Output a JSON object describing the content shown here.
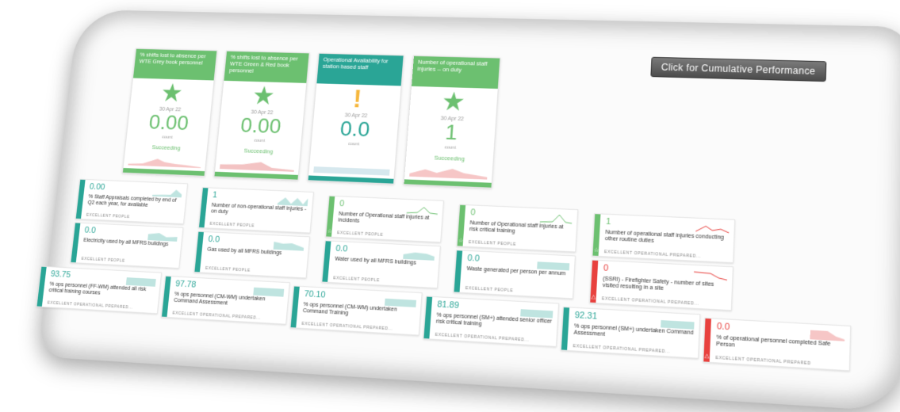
{
  "cumulative_button": "Click for Cumulative Performance",
  "kpis": [
    {
      "title": "% shifts lost to absence per WTE Grey book personnel",
      "date": "30 Apr 22",
      "value": "0.00",
      "unit": "count",
      "status": "Succeeding",
      "color": "#6cc070",
      "icon": "star-icon"
    },
    {
      "title": "% shifts lost to absence per WTE Green & Red book personnel",
      "date": "30 Apr 22",
      "value": "0.00",
      "unit": "count",
      "status": "Succeeding",
      "color": "#6cc070",
      "icon": "star-icon"
    },
    {
      "title": "Operational Availability for station based staff",
      "date": "30 Apr 22",
      "value": "0.0",
      "unit": "count",
      "status": "",
      "color": "#2aa596",
      "icon": "exclamation-icon"
    },
    {
      "title": "Number of operational staff injuries -- on duty",
      "date": "30 Apr 22",
      "value": "1",
      "unit": "count",
      "status": "Succeeding",
      "color": "#6cc070",
      "icon": "star-icon"
    }
  ],
  "tiles": [
    {
      "value": "0.00",
      "label": "% Staff Appraisals completed by end of Q2 each year, for available",
      "category": "EXCELLENT PEOPLE",
      "color": "#2aa596"
    },
    {
      "value": "1",
      "label": "Number of non-operational staff injuries - on duty",
      "category": "EXCELLENT PEOPLE",
      "color": "#2aa596"
    },
    {
      "value": "0",
      "label": "Number of Operational staff injuries at incidents",
      "category": "EXCELLENT PEOPLE",
      "color": "#6cc070"
    },
    {
      "value": "0",
      "label": "Number of Operational staff injuries at risk critical training",
      "category": "EXCELLENT PEOPLE",
      "color": "#6cc070"
    },
    {
      "value": "1",
      "label": "Number of operational staff injuries conducting other routine duties",
      "category": "EXCELLENT OPERATIONAL PREPARED...",
      "color": "#6cc070"
    },
    {
      "value": "0.0",
      "label": "Electricity used by all MFRS buildings",
      "category": "EXCELLENT PEOPLE",
      "color": "#2aa596"
    },
    {
      "value": "0.0",
      "label": "Gas used by all MFRS buildings",
      "category": "EXCELLENT PEOPLE",
      "color": "#2aa596"
    },
    {
      "value": "0.0",
      "label": "Water used by all MFRS buildings",
      "category": "EXCELLENT PEOPLE",
      "color": "#2aa596"
    },
    {
      "value": "0.0",
      "label": "Waste generated per person per annum",
      "category": "EXCELLENT PEOPLE",
      "color": "#2aa596"
    },
    {
      "value": "0",
      "label": "(SSRI) - Firefighter Safety - number of sites visited resulting in a site",
      "category": "EXCELLENT OPERATIONAL PREPARED...",
      "color": "#e8413e"
    },
    {
      "value": "93.75",
      "label": "% ops personnel (FF-WM) attended all risk critical training courses",
      "category": "EXCELLENT OPERATIONAL PREPARED...",
      "color": "#2aa596"
    },
    {
      "value": "97.78",
      "label": "% ops personnel (CM-WM) undertaken Command Assessment",
      "category": "EXCELLENT OPERATIONAL PREPARED...",
      "color": "#2aa596"
    },
    {
      "value": "70.10",
      "label": "% ops personnel (CM-WM) undertaken Command Training",
      "category": "EXCELLENT OPERATIONAL PREPARED...",
      "color": "#2aa596"
    },
    {
      "value": "81.89",
      "label": "% ops personnel (SM+) attended senior officer risk critical training",
      "category": "EXCELLENT OPERATIONAL PREPARED...",
      "color": "#2aa596"
    },
    {
      "value": "92.31",
      "label": "% ops personnel (SM+) undertaken Command Assessment",
      "category": "EXCELLENT OPERATIONAL PREPARED...",
      "color": "#2aa596"
    },
    {
      "value": "0.0",
      "label": "% of operational personnel completed Safe Person",
      "category": "EXCELLENT OPERATIONAL PREPARED",
      "color": "#e8413e"
    }
  ]
}
